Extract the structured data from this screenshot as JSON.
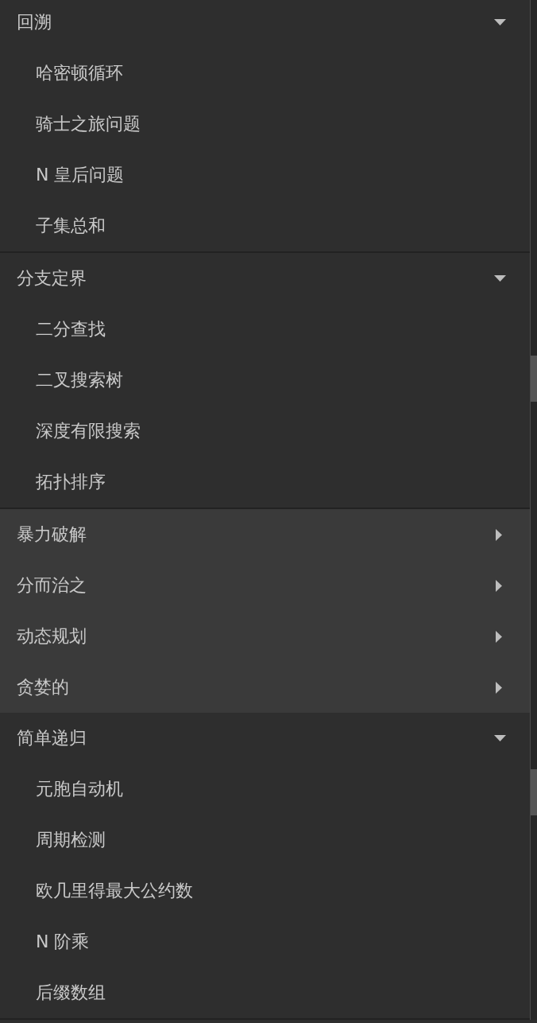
{
  "groups": [
    {
      "label": "回溯",
      "expanded": true,
      "children": [
        {
          "label": "哈密顿循环"
        },
        {
          "label": "骑士之旅问题"
        },
        {
          "label": "N 皇后问题"
        },
        {
          "label": "子集总和"
        }
      ]
    },
    {
      "label": "分支定界",
      "expanded": true,
      "children": [
        {
          "label": "二分查找"
        },
        {
          "label": "二叉搜索树"
        },
        {
          "label": "深度有限搜索"
        },
        {
          "label": "拓扑排序"
        }
      ]
    },
    {
      "label": "暴力破解",
      "expanded": false
    },
    {
      "label": "分而治之",
      "expanded": false
    },
    {
      "label": "动态规划",
      "expanded": false
    },
    {
      "label": "贪婪的",
      "expanded": false
    },
    {
      "label": "简单递归",
      "expanded": true,
      "children": [
        {
          "label": "元胞自动机"
        },
        {
          "label": "周期检测"
        },
        {
          "label": "欧几里得最大公约数"
        },
        {
          "label": "N 阶乘"
        },
        {
          "label": "后缀数组"
        }
      ]
    }
  ]
}
